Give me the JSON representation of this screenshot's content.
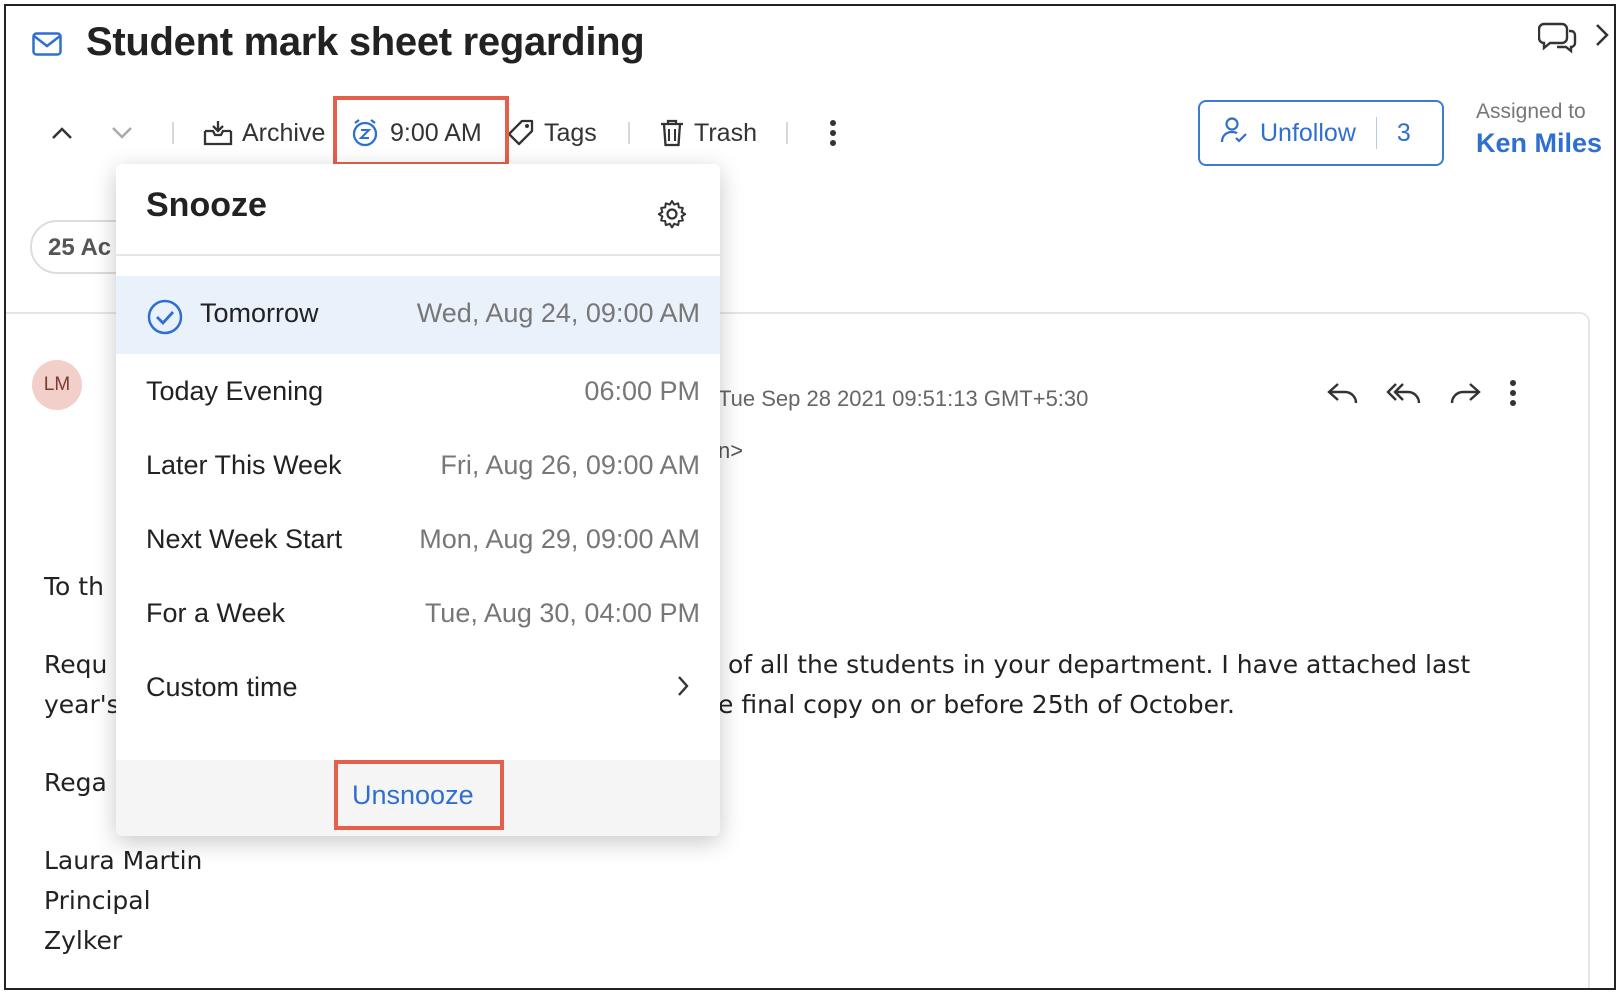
{
  "header": {
    "title": "Student mark sheet regarding"
  },
  "toolbar": {
    "archive_label": "Archive",
    "snooze_time_label": "9:00 AM",
    "tags_label": "Tags",
    "trash_label": "Trash",
    "unfollow_label": "Unfollow",
    "follower_count": "3",
    "assigned_label": "Assigned to",
    "assignee": "Ken Miles",
    "activity_pill": "25 Ac"
  },
  "snooze": {
    "title": "Snooze",
    "options": [
      {
        "label": "Tomorrow",
        "time": "Wed, Aug 24, 09:00 AM",
        "selected": true
      },
      {
        "label": "Today Evening",
        "time": "06:00 PM"
      },
      {
        "label": "Later This Week",
        "time": "Fri, Aug 26, 09:00 AM"
      },
      {
        "label": "Next Week Start",
        "time": "Mon, Aug 29, 09:00 AM"
      },
      {
        "label": "For a Week",
        "time": "Tue, Aug 30, 04:00 PM"
      },
      {
        "label": "Custom time",
        "time": ""
      }
    ],
    "unsnooze_label": "Unsnooze"
  },
  "message": {
    "avatar_initials": "LM",
    "date": "Tue Sep 28 2021 09:51:13 GMT+5:30",
    "to_fragment": "n>",
    "lines": {
      "greeting": "To th",
      "req1_left": "Requ",
      "req1_right": "of all the students in your department. I have attached last",
      "req2_left": "year's",
      "req2_right": "e final copy on or before 25th of October.",
      "regards": "Rega",
      "sig_name": "Laura Martin",
      "sig_title": "Principal",
      "sig_org": "Zylker"
    }
  },
  "colors": {
    "accent": "#2f6fcf",
    "highlight": "#e4604b",
    "selected_row": "#e9f2fb"
  }
}
